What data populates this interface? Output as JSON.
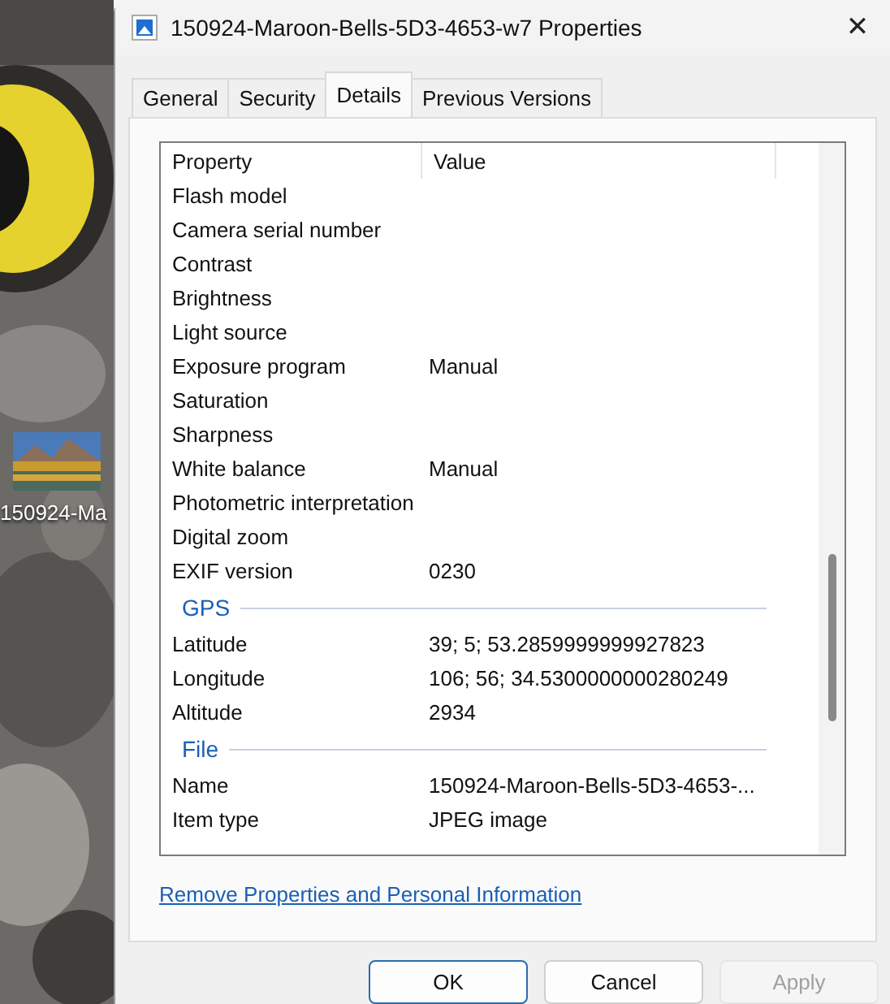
{
  "desktop": {
    "icon_label": "150924-Ma"
  },
  "window": {
    "title": "150924-Maroon-Bells-5D3-4653-w7 Properties",
    "close": "✕"
  },
  "tabs": [
    {
      "label": "General",
      "selected": false
    },
    {
      "label": "Security",
      "selected": false
    },
    {
      "label": "Details",
      "selected": true
    },
    {
      "label": "Previous Versions",
      "selected": false
    }
  ],
  "table": {
    "columns": [
      "Property",
      "Value"
    ],
    "rows": [
      {
        "kind": "row",
        "property": "Flash model"
      },
      {
        "kind": "row",
        "property": "Camera serial number"
      },
      {
        "kind": "row",
        "property": "Contrast"
      },
      {
        "kind": "row",
        "property": "Brightness"
      },
      {
        "kind": "row",
        "property": "Light source"
      },
      {
        "kind": "row",
        "property": "Exposure program",
        "value": "Manual"
      },
      {
        "kind": "row",
        "property": "Saturation"
      },
      {
        "kind": "row",
        "property": "Sharpness"
      },
      {
        "kind": "row",
        "property": "White balance",
        "value": "Manual"
      },
      {
        "kind": "row",
        "property": "Photometric interpretation"
      },
      {
        "kind": "row",
        "property": "Digital zoom"
      },
      {
        "kind": "row",
        "property": "EXIF version",
        "value": "0230"
      },
      {
        "kind": "group",
        "property": "GPS"
      },
      {
        "kind": "row",
        "property": "Latitude",
        "value": "39; 5; 53.2859999999927823"
      },
      {
        "kind": "row",
        "property": "Longitude",
        "value": "106; 56; 34.5300000000280249"
      },
      {
        "kind": "row",
        "property": "Altitude",
        "value": "2934"
      },
      {
        "kind": "group",
        "property": "File"
      },
      {
        "kind": "row",
        "property": "Name",
        "value": "150924-Maroon-Bells-5D3-4653-..."
      },
      {
        "kind": "row",
        "property": "Item type",
        "value": "JPEG image"
      }
    ]
  },
  "link": "Remove Properties and Personal Information",
  "buttons": [
    {
      "label": "OK",
      "default": true,
      "disabled": false
    },
    {
      "label": "Cancel",
      "default": false,
      "disabled": false
    },
    {
      "label": "Apply",
      "default": false,
      "disabled": true
    }
  ]
}
